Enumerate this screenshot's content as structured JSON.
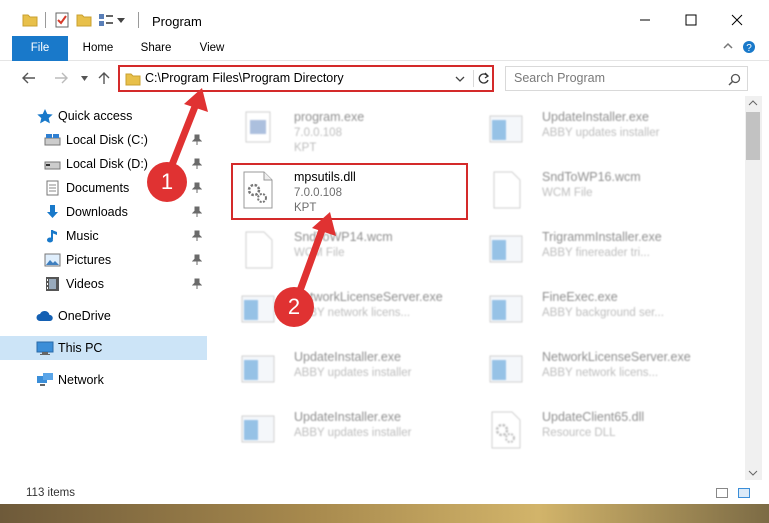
{
  "window": {
    "title": "Program",
    "controls": {
      "minimize": "minimize-icon",
      "maximize": "maximize-icon",
      "close": "close-icon"
    }
  },
  "ribbon": {
    "tabs": [
      "File",
      "Home",
      "Share",
      "View"
    ]
  },
  "nav": {
    "address": "C:\\Program Files\\Program Directory",
    "search_placeholder": "Search Program"
  },
  "sidebar": {
    "items": [
      {
        "label": "Quick access",
        "icon": "star-icon",
        "pinned": false
      },
      {
        "label": "Local Disk (C:)",
        "icon": "drive-icon",
        "pinned": true
      },
      {
        "label": "Local Disk (D:)",
        "icon": "drive-icon",
        "pinned": true
      },
      {
        "label": "Documents",
        "icon": "documents-icon",
        "pinned": true
      },
      {
        "label": "Downloads",
        "icon": "download-icon",
        "pinned": true
      },
      {
        "label": "Music",
        "icon": "music-icon",
        "pinned": true
      },
      {
        "label": "Pictures",
        "icon": "pictures-icon",
        "pinned": true
      },
      {
        "label": "Videos",
        "icon": "videos-icon",
        "pinned": true
      },
      {
        "label": "OneDrive",
        "icon": "cloud-icon",
        "pinned": false
      },
      {
        "label": "This PC",
        "icon": "computer-icon",
        "pinned": false,
        "selected": true
      },
      {
        "label": "Network",
        "icon": "network-icon",
        "pinned": false
      }
    ]
  },
  "files": [
    {
      "name": "program.exe",
      "line2": "7.0.0.108",
      "line3": "KPT",
      "icon": "exe-icon",
      "dim": true
    },
    {
      "name": "UpdateInstaller.exe",
      "line2": "ABBY updates installer",
      "line3": "",
      "icon": "app-icon",
      "dim": true
    },
    {
      "name": "mpsutils.dll",
      "line2": "7.0.0.108",
      "line3": "KPT",
      "icon": "dll-gear-icon",
      "dim": false
    },
    {
      "name": "SndToWP16.wcm",
      "line2": "WCM File",
      "line3": "",
      "icon": "blank-file-icon",
      "dim": true
    },
    {
      "name": "SndToWP14.wcm",
      "line2": "WCM File",
      "line3": "",
      "icon": "blank-file-icon",
      "dim": true
    },
    {
      "name": "TrigrammInstaller.exe",
      "line2": "ABBY finereader tri...",
      "line3": "",
      "icon": "app-icon",
      "dim": true
    },
    {
      "name": "NetworkLicenseServer.exe",
      "line2": "ABBY network licens...",
      "line3": "",
      "icon": "app-icon",
      "dim": true
    },
    {
      "name": "FineExec.exe",
      "line2": "ABBY background ser...",
      "line3": "",
      "icon": "app-icon",
      "dim": true
    },
    {
      "name": "UpdateInstaller.exe",
      "line2": "ABBY updates installer",
      "line3": "",
      "icon": "app-icon",
      "dim": true
    },
    {
      "name": "NetworkLicenseServer.exe",
      "line2": "ABBY network licens...",
      "line3": "",
      "icon": "app-icon",
      "dim": true
    },
    {
      "name": "UpdateInstaller.exe",
      "line2": "ABBY updates installer",
      "line3": "",
      "icon": "app-icon",
      "dim": true
    },
    {
      "name": "UpdateClient65.dll",
      "line2": "Resource DLL",
      "line3": "",
      "icon": "dll-gear-icon",
      "dim": true
    }
  ],
  "status": {
    "count": "113 items"
  },
  "annotations": {
    "badge1": "1",
    "badge2": "2",
    "color": "#e03232"
  }
}
